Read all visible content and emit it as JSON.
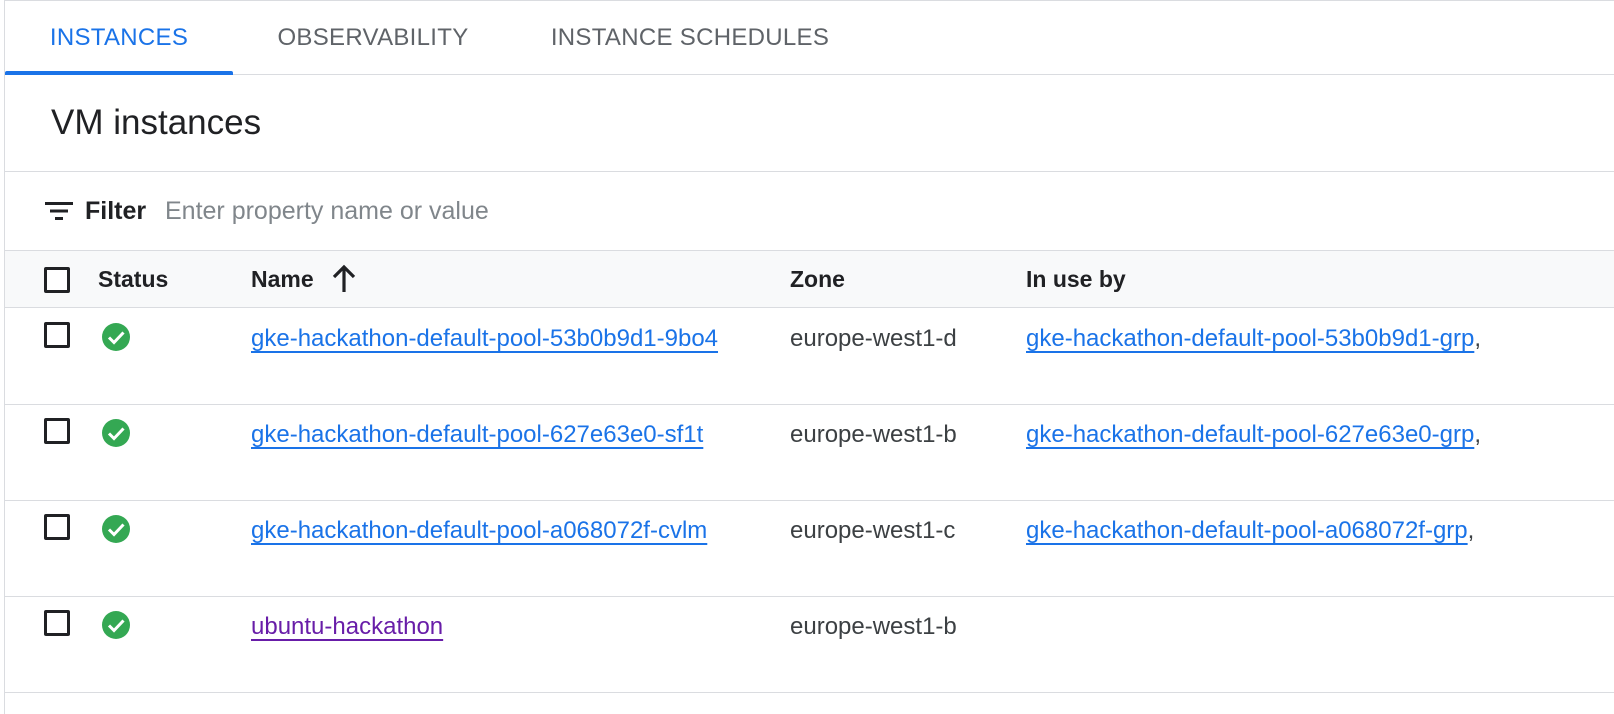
{
  "tabs": [
    {
      "label": "INSTANCES",
      "active": true
    },
    {
      "label": "OBSERVABILITY",
      "active": false
    },
    {
      "label": "INSTANCE SCHEDULES",
      "active": false
    }
  ],
  "page_title": "VM instances",
  "filter": {
    "label": "Filter",
    "icon": "filter-list-icon",
    "placeholder": "Enter property name or value"
  },
  "table": {
    "columns": {
      "status": "Status",
      "name": "Name",
      "zone": "Zone",
      "in_use_by": "In use by"
    },
    "sort_icon": "arrow-upward-icon",
    "status_icon": "check-circle-icon",
    "rows": [
      {
        "name": "gke-hackathon-default-pool-53b0b9d1-9bo4",
        "zone": "europe-west1-d",
        "in_use_by": "gke-hackathon-default-pool-53b0b9d1-grp",
        "separator": ",",
        "status": "running"
      },
      {
        "name": "gke-hackathon-default-pool-627e63e0-sf1t",
        "zone": "europe-west1-b",
        "in_use_by": "gke-hackathon-default-pool-627e63e0-grp",
        "separator": ",",
        "status": "running"
      },
      {
        "name": "gke-hackathon-default-pool-a068072f-cvlm",
        "zone": "europe-west1-c",
        "in_use_by": "gke-hackathon-default-pool-a068072f-grp",
        "separator": ",",
        "status": "running"
      },
      {
        "name": "ubuntu-hackathon",
        "zone": "europe-west1-b",
        "in_use_by": "",
        "separator": "",
        "status": "running"
      }
    ]
  },
  "colors": {
    "accent": "#1a73e8",
    "visited_link": "#681da8",
    "status_ok": "#34a853"
  }
}
